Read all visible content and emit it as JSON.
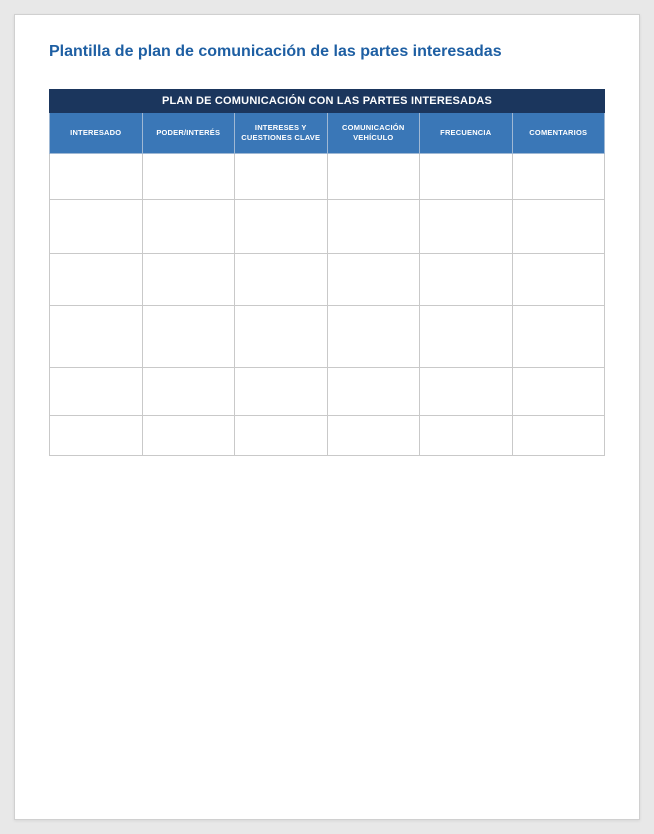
{
  "document": {
    "title": "Plantilla de plan de comunicación de las partes interesadas"
  },
  "table": {
    "title": "PLAN DE COMUNICACIÓN CON LAS PARTES INTERESADAS",
    "columns": [
      "INTERESADO",
      "PODER/INTERÉS",
      "INTERESES Y CUESTIONES CLAVE",
      "COMUNICACIÓN VEHÍCULO",
      "FRECUENCIA",
      "COMENTARIOS"
    ],
    "rows": [
      [
        "",
        "",
        "",
        "",
        "",
        ""
      ],
      [
        "",
        "",
        "",
        "",
        "",
        ""
      ],
      [
        "",
        "",
        "",
        "",
        "",
        ""
      ],
      [
        "",
        "",
        "",
        "",
        "",
        ""
      ],
      [
        "",
        "",
        "",
        "",
        "",
        ""
      ],
      [
        "",
        "",
        "",
        "",
        "",
        ""
      ]
    ]
  }
}
